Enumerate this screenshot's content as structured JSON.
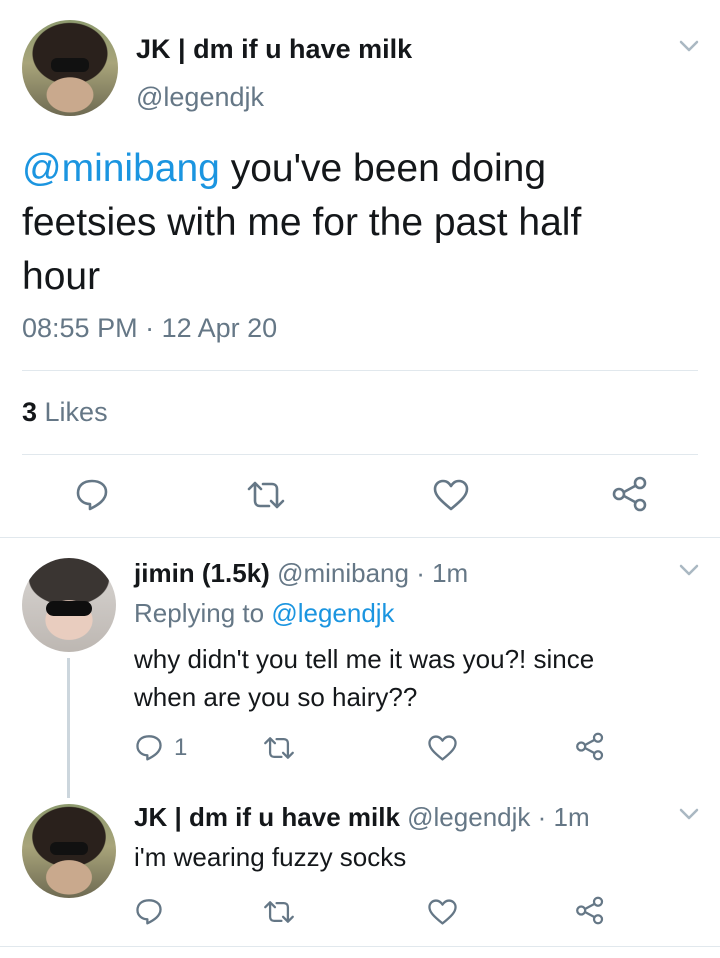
{
  "main_tweet": {
    "display_name": "JK | dm if u have milk",
    "handle": "@legendjk",
    "mention": "@minibang",
    "text_line1": " you've been doing",
    "text_line2": "feetsies with me for the past half",
    "text_line3": "hour",
    "time": "08:55 PM",
    "separator": " · ",
    "date": "12 Apr 20",
    "likes_count": "3",
    "likes_label": " Likes"
  },
  "reply1": {
    "display_name": "jimin (1.5k)",
    "handle": "@minibang",
    "dot": " · ",
    "time": "1m",
    "replying_label": "Replying to ",
    "replying_handle": "@legendjk",
    "text_line1": "why didn't you tell me it was you?! since",
    "text_line2": "when are you so hairy??",
    "reply_count": "1"
  },
  "reply2": {
    "display_name": "JK | dm if u have milk",
    "handle": "@legendjk",
    "dot": " · ",
    "time": "1m",
    "text_line1": "i'm wearing fuzzy socks"
  },
  "icons": {
    "reply": "reply-icon",
    "retweet": "retweet-icon",
    "like": "heart-icon",
    "share": "share-icon",
    "more": "chevron-down-icon"
  },
  "colors": {
    "link": "#1b95e0",
    "secondary": "#657786",
    "text": "#14171a",
    "divider": "#e1e8ed"
  }
}
